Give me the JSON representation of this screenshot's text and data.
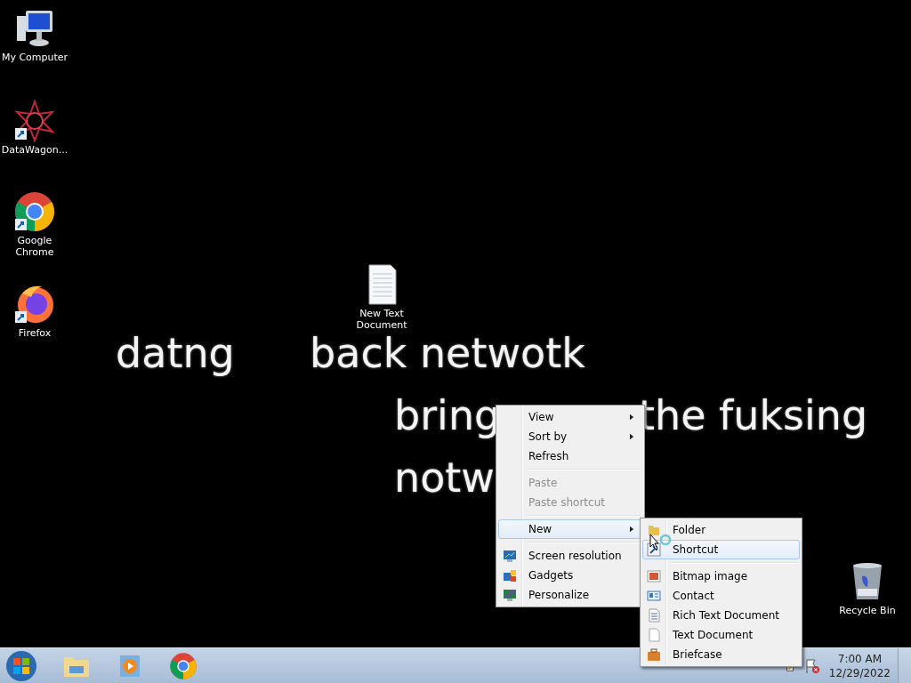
{
  "desktop_icons": [
    {
      "label": "My Computer"
    },
    {
      "label": "DataWagon..."
    },
    {
      "label": "Google Chrome"
    },
    {
      "label": "Firefox"
    },
    {
      "label": "New Text Document"
    },
    {
      "label": "Recycle Bin"
    }
  ],
  "wallpaper_text": [
    "datng",
    "back netwotk",
    "bring",
    "the fuksing",
    "notw"
  ],
  "context_menu": {
    "items": [
      {
        "kind": "item",
        "label": "View",
        "submenu": true,
        "disabled": false,
        "selected": false
      },
      {
        "kind": "item",
        "label": "Sort by",
        "submenu": true,
        "disabled": false,
        "selected": false
      },
      {
        "kind": "item",
        "label": "Refresh",
        "submenu": false,
        "disabled": false,
        "selected": false
      },
      {
        "kind": "separator"
      },
      {
        "kind": "item",
        "label": "Paste",
        "submenu": false,
        "disabled": true,
        "selected": false
      },
      {
        "kind": "item",
        "label": "Paste shortcut",
        "submenu": false,
        "disabled": true,
        "selected": false
      },
      {
        "kind": "separator"
      },
      {
        "kind": "item",
        "label": "New",
        "submenu": true,
        "disabled": false,
        "selected": true
      },
      {
        "kind": "separator"
      },
      {
        "kind": "item",
        "label": "Screen resolution",
        "submenu": false,
        "disabled": false,
        "selected": false
      },
      {
        "kind": "item",
        "label": "Gadgets",
        "submenu": false,
        "disabled": false,
        "selected": false
      },
      {
        "kind": "item",
        "label": "Personalize",
        "submenu": false,
        "disabled": false,
        "selected": false
      }
    ]
  },
  "new_submenu": {
    "items": [
      {
        "kind": "item",
        "label": "Folder",
        "selected": false
      },
      {
        "kind": "item",
        "label": "Shortcut",
        "selected": true
      },
      {
        "kind": "separator"
      },
      {
        "kind": "item",
        "label": "Bitmap image",
        "selected": false
      },
      {
        "kind": "item",
        "label": "Contact",
        "selected": false
      },
      {
        "kind": "item",
        "label": "Rich Text Document",
        "selected": false
      },
      {
        "kind": "item",
        "label": "Text Document",
        "selected": false
      },
      {
        "kind": "item",
        "label": "Briefcase",
        "selected": false
      }
    ]
  },
  "taskbar": {
    "clock": {
      "time": "7:00 AM",
      "date": "12/29/2022"
    }
  }
}
